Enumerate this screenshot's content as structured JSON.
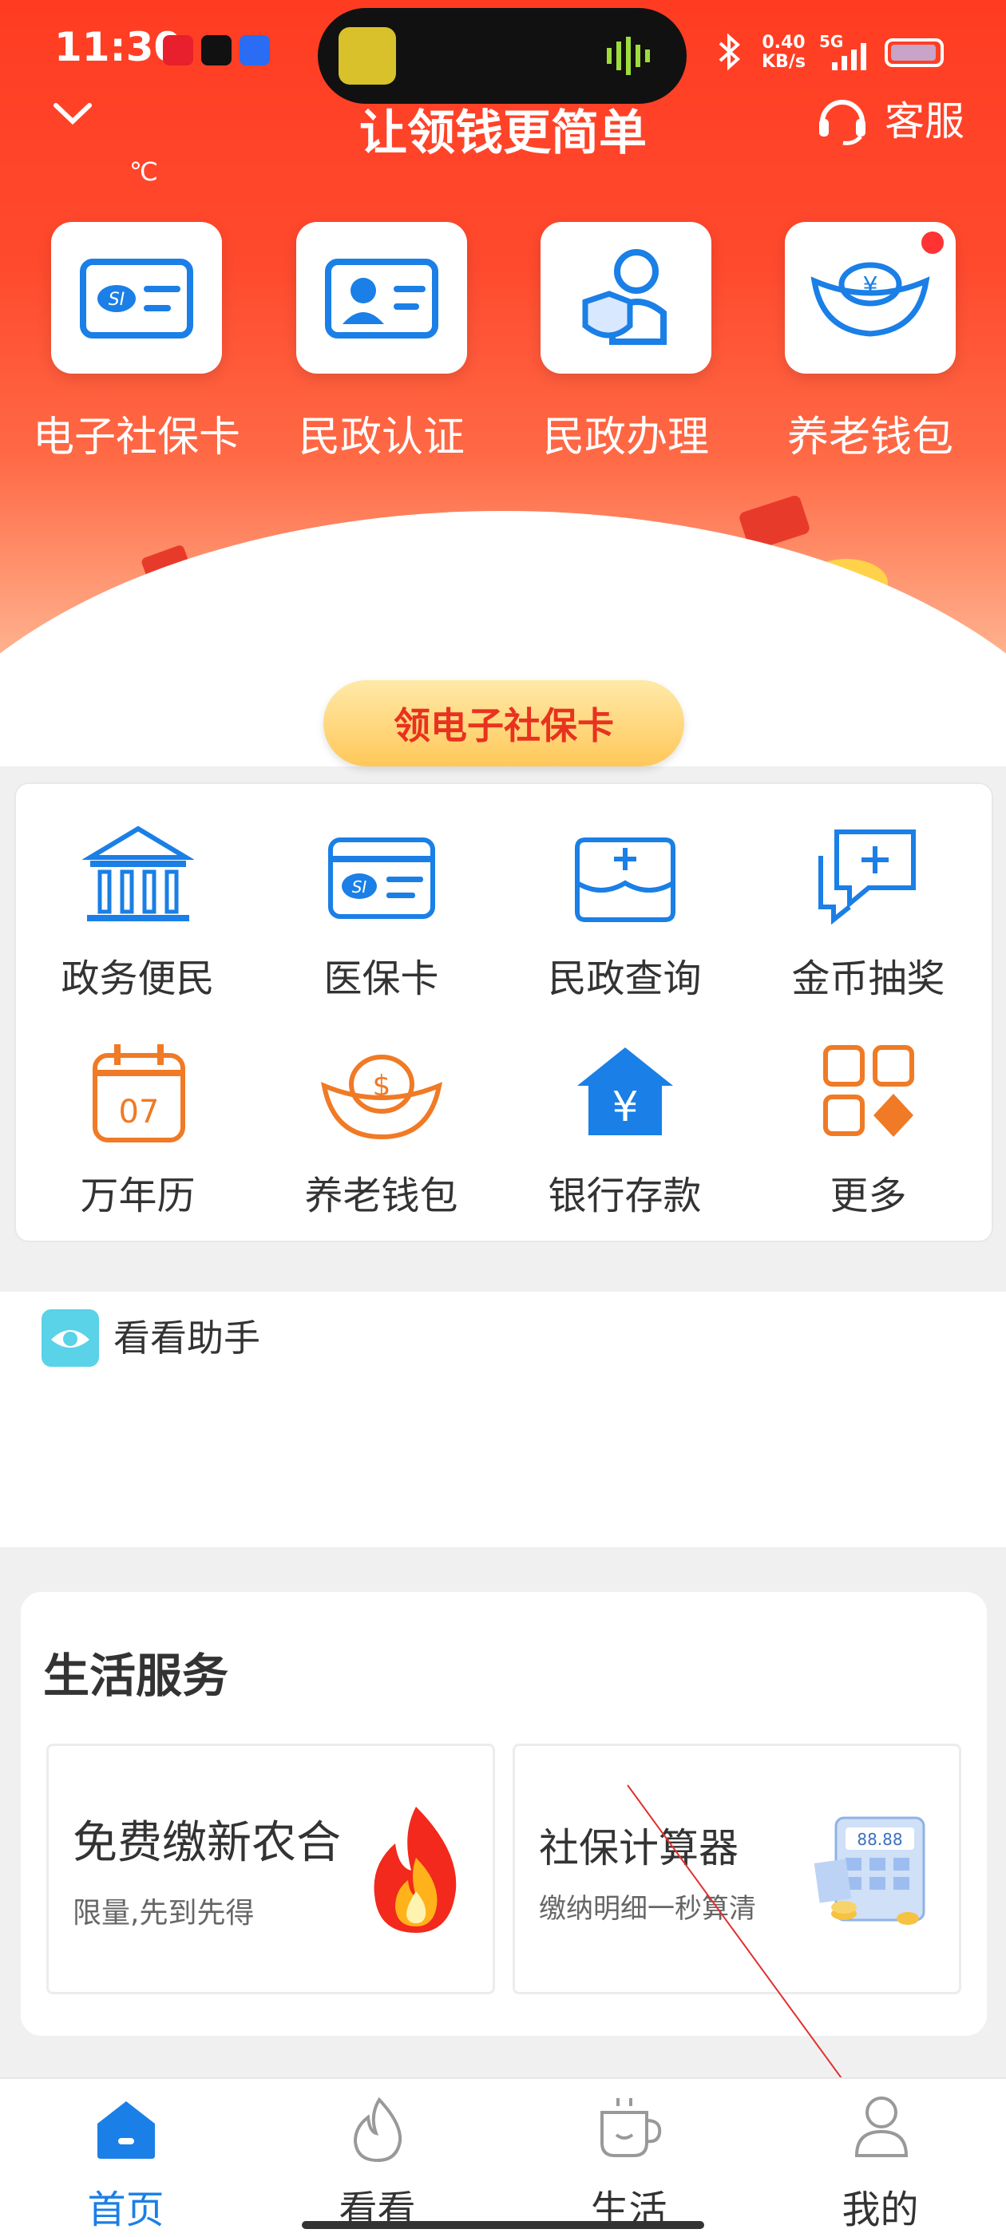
{
  "status_bar": {
    "time": "11:30",
    "net_speed": "0.40",
    "net_unit": "KB/s",
    "net_type": "5G"
  },
  "header": {
    "title": "让领钱更简单",
    "service_label": "客服",
    "temp_unit": "℃"
  },
  "quick_tiles": [
    {
      "label": "电子社保卡",
      "icon": "social-security-card-icon"
    },
    {
      "label": "民政认证",
      "icon": "id-card-icon"
    },
    {
      "label": "民政办理",
      "icon": "person-shield-icon"
    },
    {
      "label": "养老钱包",
      "icon": "gold-ingot-icon"
    }
  ],
  "banner": {
    "button_label": "领电子社保卡"
  },
  "services": [
    {
      "label": "政务便民",
      "icon": "government-building-icon"
    },
    {
      "label": "医保卡",
      "icon": "medical-card-icon"
    },
    {
      "label": "民政查询",
      "icon": "civil-query-icon"
    },
    {
      "label": "金币抽奖",
      "icon": "chat-plus-icon"
    },
    {
      "label": "万年历",
      "icon": "calendar-icon",
      "day": "07"
    },
    {
      "label": "养老钱包",
      "icon": "ingot-icon"
    },
    {
      "label": "银行存款",
      "icon": "bank-house-icon"
    },
    {
      "label": "更多",
      "icon": "more-grid-icon"
    }
  ],
  "assistant": {
    "label": "看看助手"
  },
  "life_services": {
    "title": "生活服务",
    "cards": [
      {
        "title": "免费缴新农合",
        "subtitle": "限量,先到先得",
        "icon": "fire-icon"
      },
      {
        "title": "社保计算器",
        "subtitle": "缴纳明细一秒算清",
        "icon": "calculator-icon",
        "calc_display": "88.88"
      }
    ]
  },
  "tabs": [
    {
      "label": "首页",
      "icon": "home-icon",
      "active": true
    },
    {
      "label": "看看",
      "icon": "flame-icon",
      "active": false
    },
    {
      "label": "生活",
      "icon": "coffee-cup-icon",
      "active": false
    },
    {
      "label": "我的",
      "icon": "user-icon",
      "active": false
    }
  ],
  "colors": {
    "primary_red": "#ff3c22",
    "blue": "#1a7fe6",
    "orange": "#f07a25",
    "active_tab": "#1a7fe6"
  }
}
